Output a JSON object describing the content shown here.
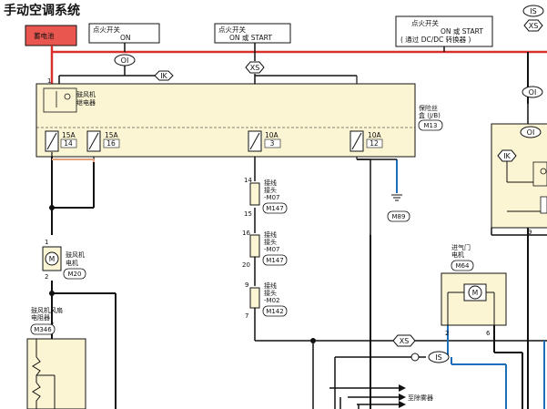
{
  "title": "手动空调系统",
  "legend": {
    "is": "IS",
    "xs": "XS"
  },
  "battery": "蓄电池",
  "ign_on": {
    "line1": "点火开关",
    "line2": "ON"
  },
  "ign_on_start": {
    "line1": "点火开关",
    "line2": "ON 或 START"
  },
  "ign_dcdc": {
    "line1": "点火开关",
    "line2": "ON 或 START",
    "line3": "( 通过 DC/DC 转换器 )"
  },
  "tags": {
    "oi": "OI",
    "ik": "IK",
    "xs": "XS",
    "is": "IS"
  },
  "relay": {
    "line1": "鼓风机",
    "line2": "继电器"
  },
  "jb": {
    "line1": "保险丝",
    "line2": "盒 (J/B)",
    "conn": "M13"
  },
  "fuses": [
    {
      "amp": "15A",
      "num": "14"
    },
    {
      "amp": "15A",
      "num": "16"
    },
    {
      "amp": "10A",
      "num": "3"
    },
    {
      "amp": "10A",
      "num": "12"
    }
  ],
  "ground_conn": "M89",
  "blower_motor": {
    "line1": "鼓风机",
    "line2": "电机",
    "conn": "M20",
    "pin_top": "1",
    "pin_bot": "2"
  },
  "joints": [
    {
      "line1": "接线",
      "line2": "接头",
      "line3": "-M07",
      "conn": "M147",
      "pin_top": "14",
      "pin_bot": "15"
    },
    {
      "line1": "接线",
      "line2": "接头",
      "line3": "-M07",
      "conn": "M147",
      "pin_top": "16",
      "pin_bot": "20"
    },
    {
      "line1": "接线",
      "line2": "接头",
      "line3": "-M02",
      "conn": "M142",
      "pin_top": "9",
      "pin_bot": "7"
    }
  ],
  "resistor": {
    "line1": "鼓风机风扇",
    "line2": "电阻器",
    "mark": "*",
    "conn": "M346"
  },
  "intake_door": {
    "line1": "进气门",
    "line2": "电机",
    "conn": "M64",
    "pin_l": "2",
    "pin_r": "6"
  },
  "defogger": "至除雾器",
  "relay_pin": "1",
  "right_pin": "9",
  "motor_symbol": "M",
  "colors": {
    "battery_fill": "#e8564f",
    "box_fill": "#fbf5d3",
    "power": "#d9302c",
    "signal": "#1a6fb8",
    "wire": "#111111",
    "orange_wire": "#e3a27a"
  }
}
